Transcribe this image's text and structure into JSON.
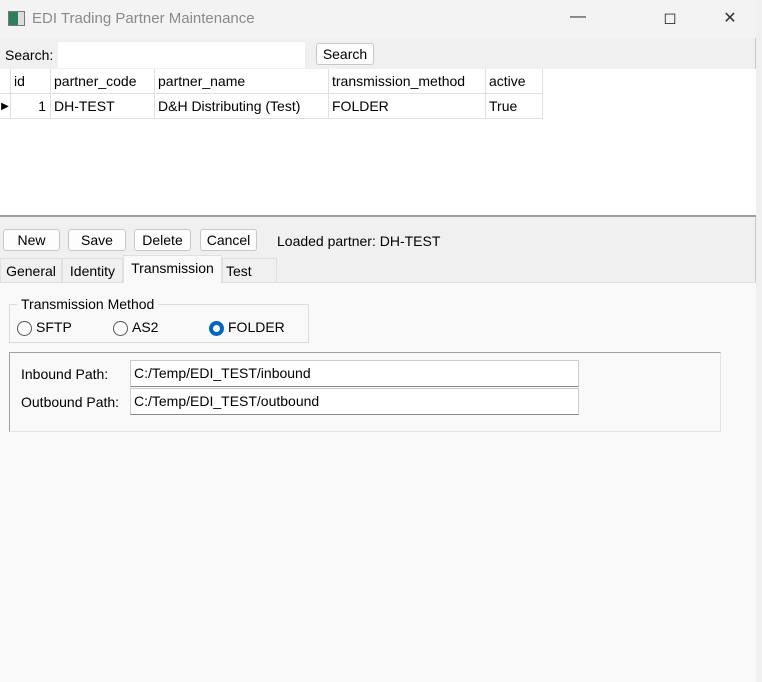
{
  "window": {
    "title": "EDI Trading Partner Maintenance",
    "controls": [
      "minimize",
      "maximize",
      "close"
    ]
  },
  "search": {
    "label": "Search:",
    "value": "",
    "button": "Search"
  },
  "grid": {
    "columns": [
      "id",
      "partner_code",
      "partner_name",
      "transmission_method",
      "active"
    ],
    "rows": [
      [
        "1",
        "DH-TEST",
        "D&H Distributing (Test)",
        "FOLDER",
        "True"
      ]
    ]
  },
  "toolbar": {
    "new": "New",
    "save": "Save",
    "delete": "Delete",
    "cancel": "Cancel",
    "status": "Loaded partner: DH-TEST"
  },
  "tabs": [
    {
      "label": "General"
    },
    {
      "label": "Identity"
    },
    {
      "label": "Transmission",
      "selected": true
    },
    {
      "label": "Test"
    }
  ],
  "transmission": {
    "group_label": "Transmission Method",
    "options": [
      "SFTP",
      "AS2",
      "FOLDER"
    ],
    "selected": "FOLDER",
    "inbound_label": "Inbound Path:",
    "inbound_value": "C:/Temp/EDI_TEST/inbound",
    "outbound_label": "Outbound Path:",
    "outbound_value": "C:/Temp/EDI_TEST/outbound"
  },
  "colors": {
    "accent": "#0067c0"
  }
}
